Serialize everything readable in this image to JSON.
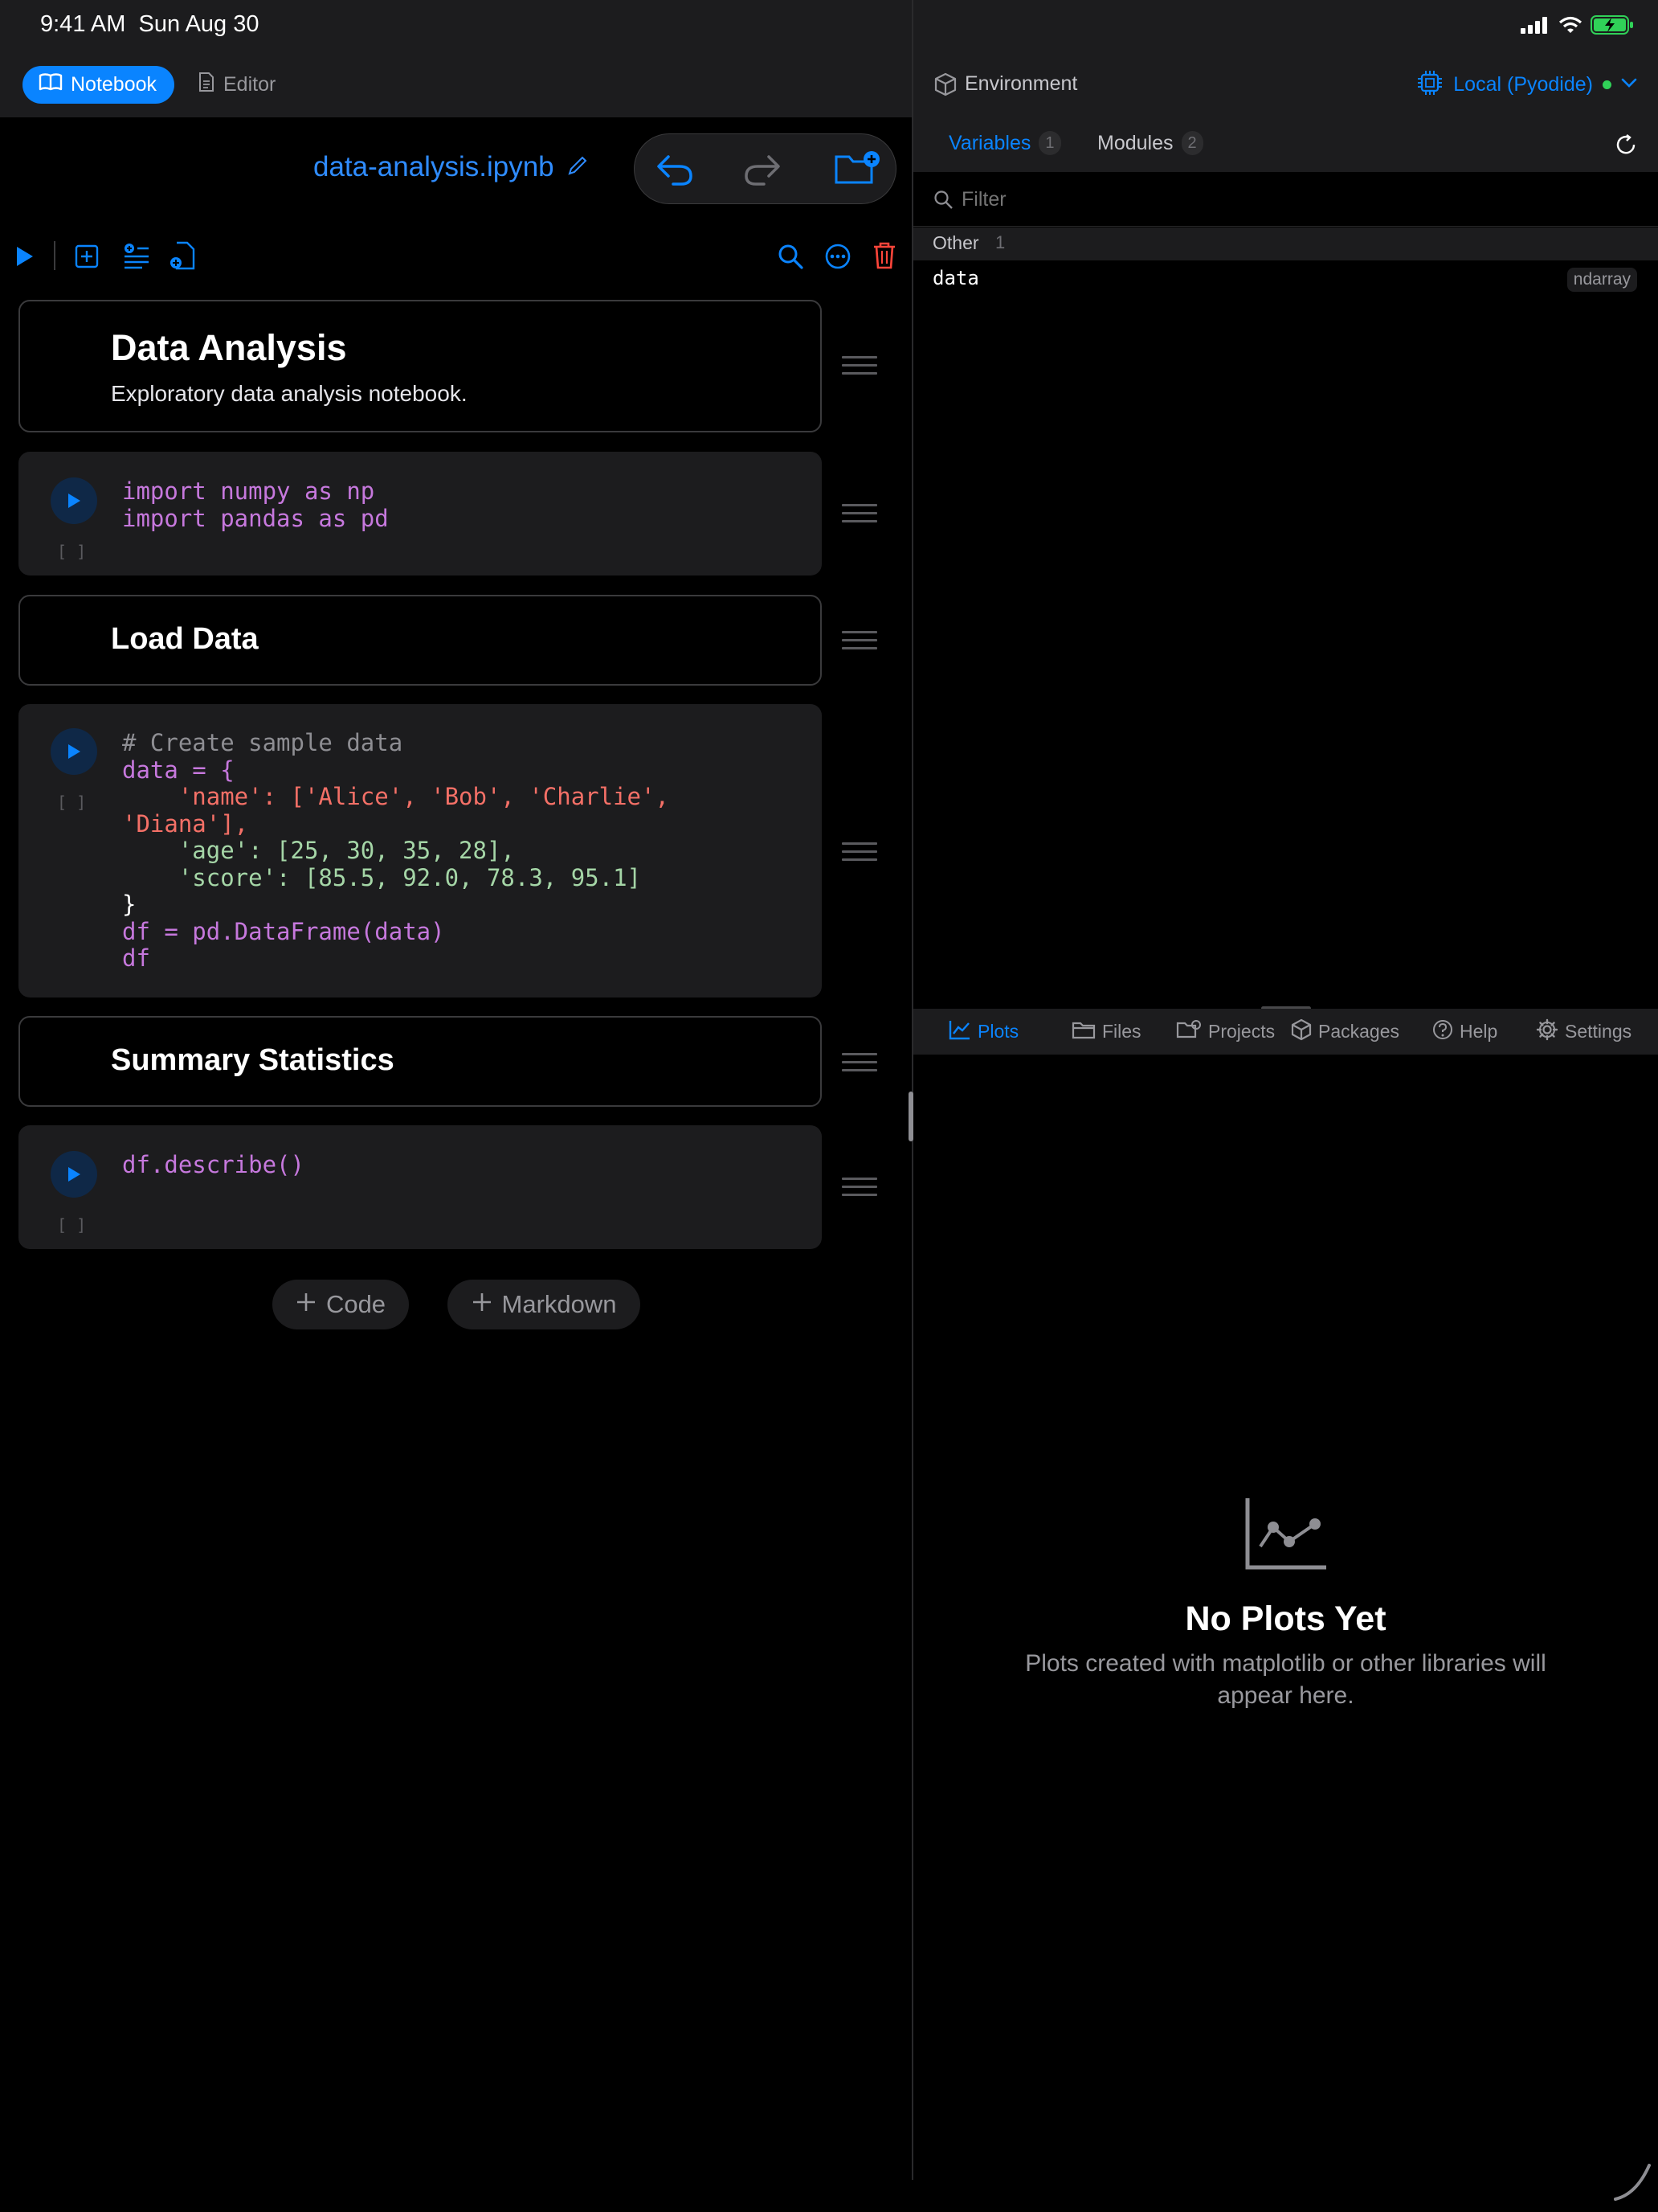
{
  "status": {
    "time": "9:41 AM",
    "date": "Sun Aug 30"
  },
  "nav": {
    "notebook_label": "Notebook",
    "editor_label": "Editor"
  },
  "notebook": {
    "title": "data-analysis.ipynb"
  },
  "cells": {
    "c1": {
      "title": "Data Analysis",
      "text": "Exploratory data analysis notebook."
    },
    "c2": {
      "bracket": "[ ]"
    },
    "c3": {
      "title": "Load Data"
    },
    "c4": {
      "bracket": "[ ]"
    },
    "c5": {
      "title": "Summary Statistics"
    },
    "c6": {
      "bracket": "[ ]"
    }
  },
  "code_lines": {
    "c2": [
      "import numpy as np",
      "import pandas as pd"
    ],
    "c4": [
      "# Create sample data",
      "data = {",
      "    'name': ['Alice', 'Bob', 'Charlie',",
      "'Diana'],",
      "    'age': [25, 30, 35, 28],",
      "    'score': [85.5, 92.0, 78.3, 95.1]",
      "}",
      "df = pd.DataFrame(data)",
      "df"
    ],
    "c6": [
      "df.describe()"
    ]
  },
  "add": {
    "code": "Code",
    "markdown": "Markdown"
  },
  "env": {
    "title": "Environment",
    "runtime": "Local (Pyodide)",
    "tab_variables": "Variables",
    "variables_count": "1",
    "tab_modules": "Modules",
    "modules_count": "2",
    "filter_placeholder": "Filter",
    "section": "Other",
    "section_count": "1",
    "var_name": "data",
    "var_type": "ndarray"
  },
  "bottom_tabs": {
    "plots": "Plots",
    "files": "Files",
    "projects": "Projects",
    "packages": "Packages",
    "help": "Help",
    "settings": "Settings"
  },
  "empty": {
    "title": "No Plots Yet",
    "subtitle": "Plots created with matplotlib or other libraries will appear here."
  },
  "colors": {
    "accent": "#0a84ff",
    "danger": "#ff453a",
    "status_green": "#30d158"
  }
}
